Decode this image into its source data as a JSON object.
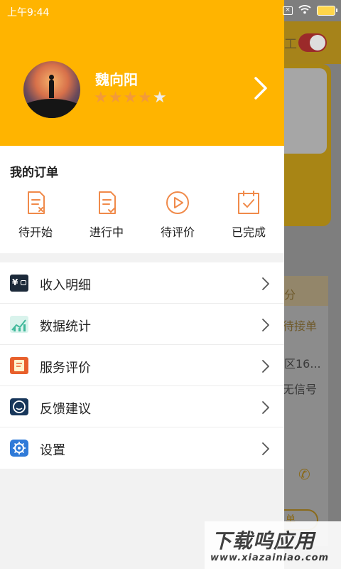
{
  "status_bar": {
    "time": "上午9:44",
    "icons": [
      "sim-off-icon",
      "wifi-icon",
      "battery-charging-icon"
    ]
  },
  "profile": {
    "name": "魏向阳",
    "rating": 4,
    "rating_max": 5
  },
  "orders": {
    "title": "我的订单",
    "items": [
      {
        "label": "待开始",
        "icon": "order-pending-icon"
      },
      {
        "label": "进行中",
        "icon": "order-in-progress-icon"
      },
      {
        "label": "待评价",
        "icon": "order-to-review-icon"
      },
      {
        "label": "已完成",
        "icon": "order-completed-icon"
      }
    ]
  },
  "menu": {
    "items": [
      {
        "label": "收入明细",
        "icon": "wallet-icon"
      },
      {
        "label": "数据统计",
        "icon": "stats-icon"
      },
      {
        "label": "服务评价",
        "icon": "review-icon"
      },
      {
        "label": "反馈建议",
        "icon": "feedback-icon"
      },
      {
        "label": "设置",
        "icon": "settings-icon"
      }
    ]
  },
  "background": {
    "toggle_label": "工",
    "text_fen": "分",
    "text_status": "待接单",
    "text_address": "区16...",
    "text_signal": "无信号",
    "button_label": "单"
  },
  "watermark": {
    "main": "下载呜应用",
    "sub": "www.xiazainiao.com"
  },
  "colors": {
    "header_bg": "#ffb400",
    "icon_accent": "#f08a4a",
    "star_filled": "#f29a3a",
    "star_empty": "#ececec"
  }
}
